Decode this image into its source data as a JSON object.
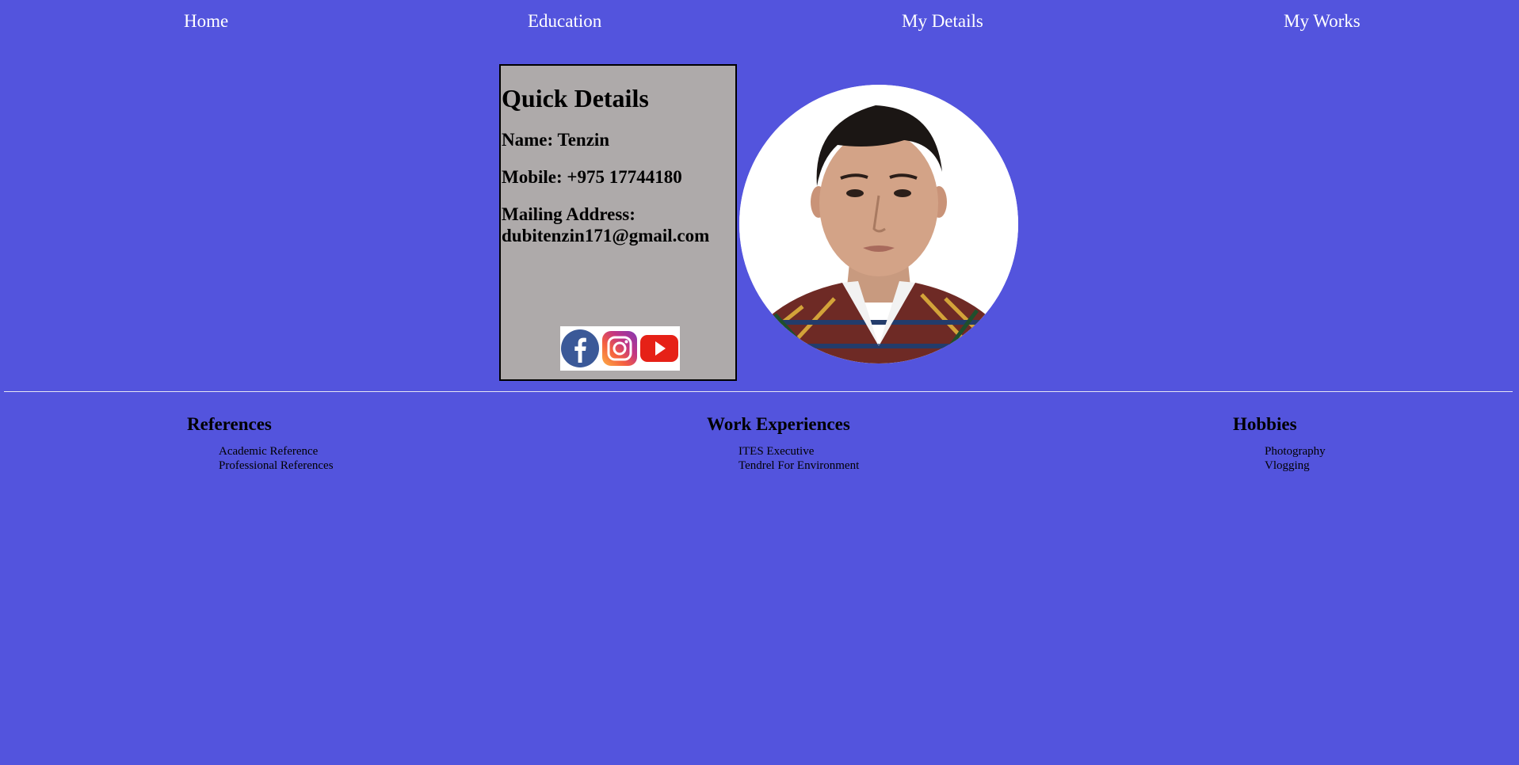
{
  "nav": {
    "items": [
      {
        "label": "Home"
      },
      {
        "label": "Education"
      },
      {
        "label": "My Details"
      },
      {
        "label": "My Works"
      }
    ]
  },
  "quick_details": {
    "title": "Quick Details",
    "name": "Name: Tenzin",
    "mobile": "Mobile: +975 17744180",
    "mailing_label": "Mailing Address:",
    "mailing_value": "dubitenzin171@gmail.com",
    "social_icons": [
      "facebook-icon",
      "instagram-icon",
      "youtube-icon"
    ]
  },
  "sections": [
    {
      "title": "References",
      "items": [
        "Academic Reference",
        "Professional References"
      ]
    },
    {
      "title": "Work Experiences",
      "items": [
        "ITES Executive",
        "Tendrel For Environment"
      ]
    },
    {
      "title": "Hobbies",
      "items": [
        "Photography",
        "Vlogging"
      ]
    }
  ],
  "colors": {
    "background": "#5354dd",
    "card": "#aeaaaa",
    "nav_text": "#ffffff",
    "facebook": "#3b5998",
    "youtube": "#e62117"
  }
}
